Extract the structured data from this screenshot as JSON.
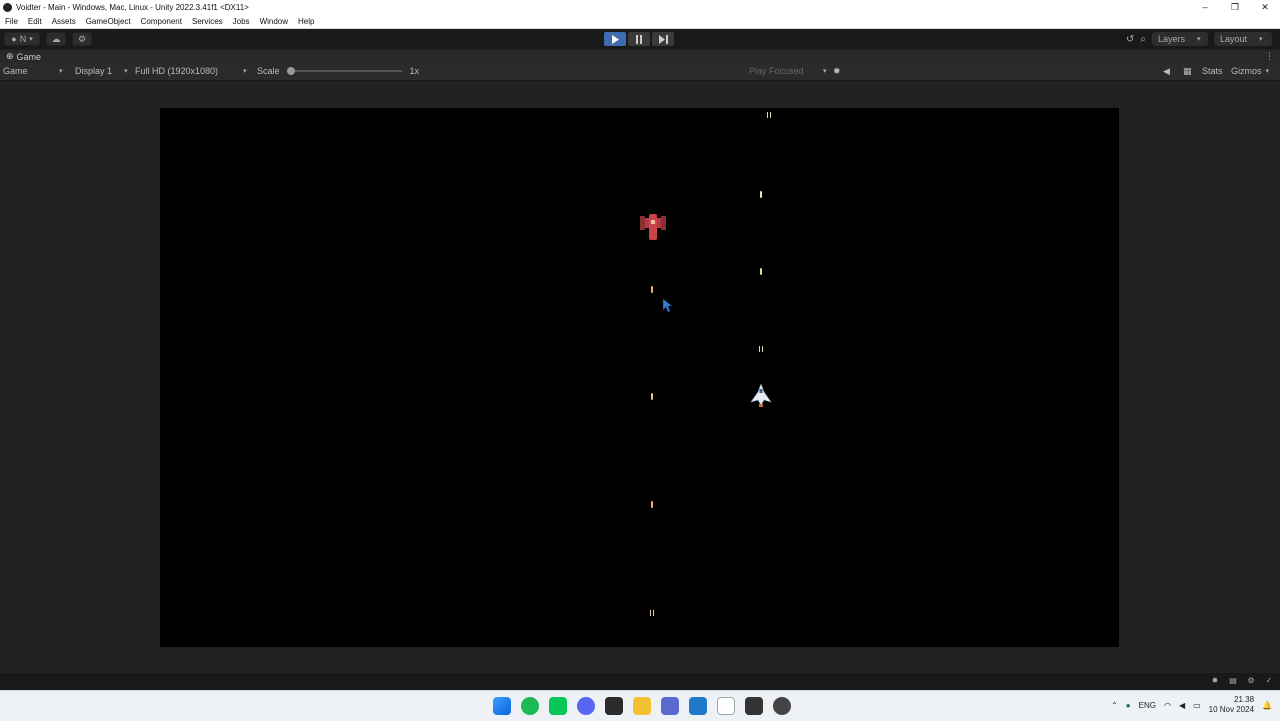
{
  "window": {
    "title": "Voidter - Main - Windows, Mac, Linux - Unity 2022.3.41f1 <DX11>",
    "controls": [
      "–",
      "❐",
      "✕"
    ]
  },
  "menu": [
    "File",
    "Edit",
    "Assets",
    "GameObject",
    "Component",
    "Services",
    "Jobs",
    "Window",
    "Help"
  ],
  "toolbar": {
    "account_label": "N",
    "layers_label": "Layers",
    "layout_label": "Layout",
    "play_state": "playing"
  },
  "game_tab": {
    "label": "Game"
  },
  "game_view": {
    "view_mode": "Game",
    "display": "Display 1",
    "resolution": "Full HD (1920x1080)",
    "scale_label": "Scale",
    "scale_value": "1x",
    "play_mode": "Play Focused",
    "stats_label": "Stats",
    "gizmos_label": "Gizmos"
  },
  "scene": {
    "player_ship": "white fighter ship",
    "enemy_ship": "red enemy ship",
    "player_bullet_count": 4,
    "enemy_bullet_count": 4
  },
  "taskbar": {
    "apps": [
      "windows-start",
      "spotify",
      "line",
      "discord",
      "terminal",
      "file-explorer",
      "unity-hub",
      "vscode",
      "notepad",
      "unity",
      "recorder"
    ],
    "language": "ENG",
    "time": "21.38",
    "date": "10 Nov 2024"
  },
  "colors": {
    "play_active": "#3d6db0",
    "viewport_bg": "#000000",
    "editor_bg": "#222222"
  }
}
